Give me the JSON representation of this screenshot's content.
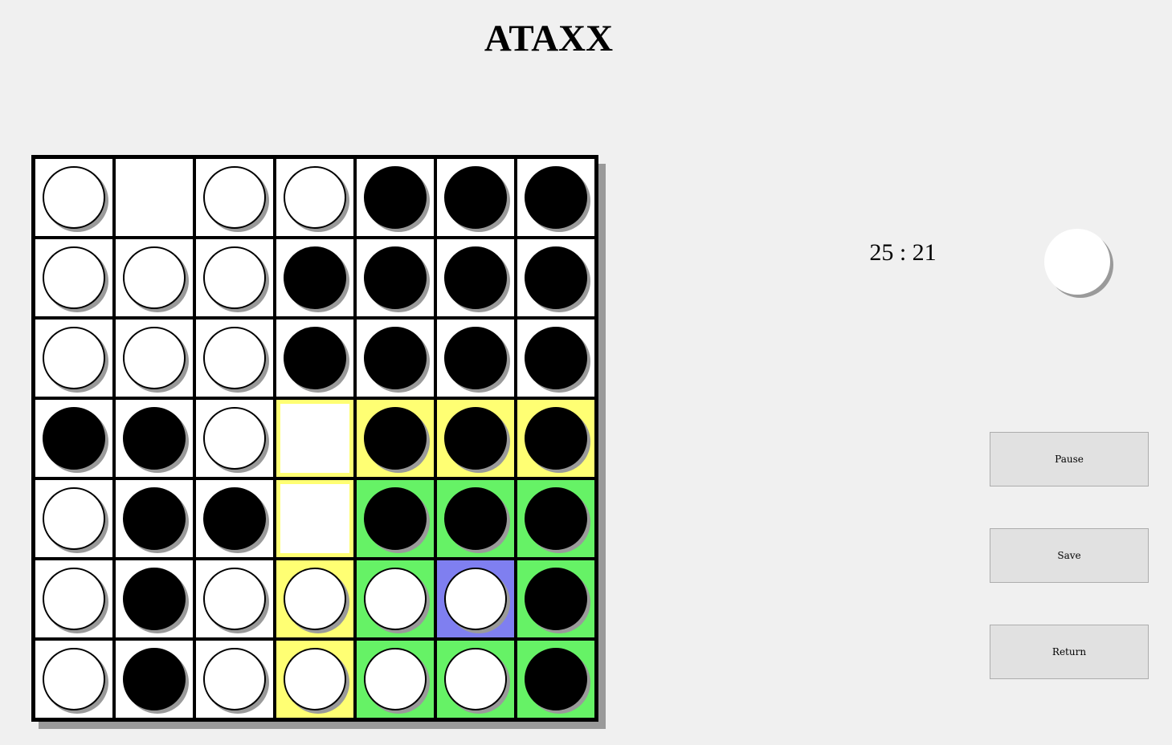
{
  "title": "ATAXX",
  "score": {
    "white": 25,
    "black": 21,
    "text": "25 : 21"
  },
  "current_turn": "white",
  "buttons": {
    "pause": "Pause",
    "save": "Save",
    "return": "Return"
  },
  "colors": {
    "highlight_yellow": "#ffff73",
    "highlight_green": "#66f266",
    "highlight_selected": "#7f7ff0",
    "background": "#f0f0f0"
  },
  "board": {
    "size": 7,
    "pieces": [
      [
        "W",
        "",
        "W",
        "W",
        "B",
        "B",
        "B"
      ],
      [
        "W",
        "W",
        "W",
        "B",
        "B",
        "B",
        "B"
      ],
      [
        "W",
        "W",
        "W",
        "B",
        "B",
        "B",
        "B"
      ],
      [
        "B",
        "B",
        "W",
        "",
        "B",
        "B",
        "B"
      ],
      [
        "W",
        "B",
        "B",
        "",
        "B",
        "B",
        "B"
      ],
      [
        "W",
        "B",
        "W",
        "W",
        "W",
        "W",
        "B"
      ],
      [
        "W",
        "B",
        "W",
        "W",
        "W",
        "W",
        "B"
      ]
    ],
    "highlights": [
      [
        "",
        "",
        "",
        "",
        "",
        "",
        ""
      ],
      [
        "",
        "",
        "",
        "",
        "",
        "",
        ""
      ],
      [
        "",
        "",
        "",
        "",
        "",
        "",
        ""
      ],
      [
        "",
        "",
        "",
        "yellow",
        "yellow",
        "yellow",
        "yellow"
      ],
      [
        "",
        "",
        "",
        "yellow",
        "green",
        "green",
        "green"
      ],
      [
        "",
        "",
        "",
        "yellow",
        "green",
        "selected",
        "green"
      ],
      [
        "",
        "",
        "",
        "yellow",
        "green",
        "green",
        "green"
      ]
    ]
  }
}
